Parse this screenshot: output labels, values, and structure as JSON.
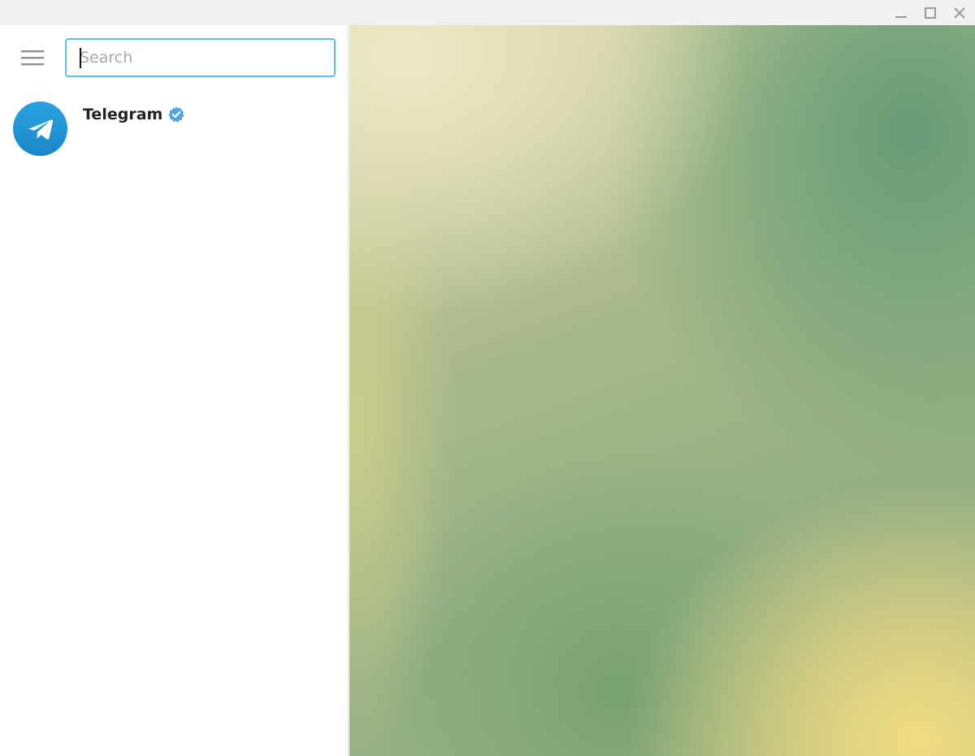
{
  "window": {
    "controls": {
      "minimize_icon": "minimize-icon",
      "maximize_icon": "maximize-icon",
      "close_icon": "close-icon"
    }
  },
  "sidebar": {
    "menu_icon": "hamburger-menu-icon",
    "search": {
      "placeholder": "Search",
      "value": ""
    },
    "chats": [
      {
        "name": "Telegram",
        "verified": true,
        "avatar_icon": "telegram-plane-icon",
        "verified_icon": "verified-badge-icon"
      }
    ]
  },
  "colors": {
    "accent": "#5bbfe8",
    "avatar_top": "#2aa3e0",
    "avatar_bottom": "#1b86c9",
    "verified": "#4ea4e6"
  }
}
